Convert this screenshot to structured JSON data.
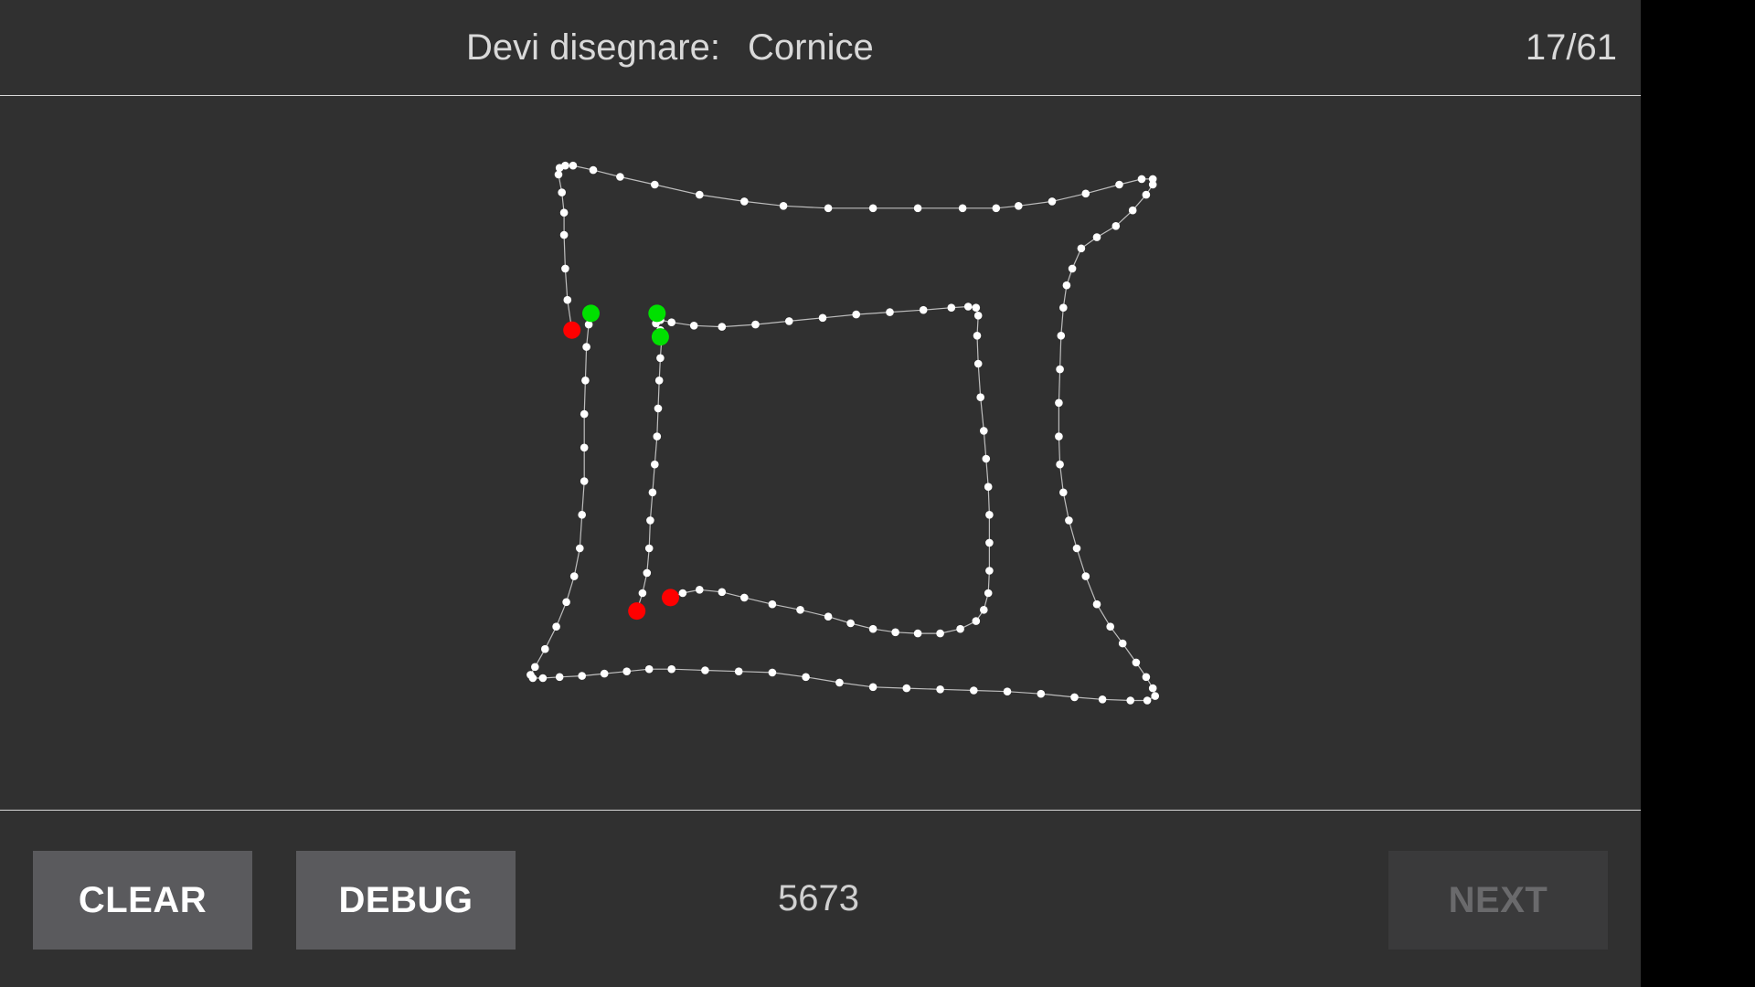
{
  "header": {
    "prompt_label": "Devi disegnare:",
    "target_word": "Cornice",
    "progress": "17/61"
  },
  "footer": {
    "clear_label": "CLEAR",
    "debug_label": "DEBUG",
    "score": "5673",
    "next_label": "NEXT"
  },
  "colors": {
    "background": "#303030",
    "stroke": "#ffffff",
    "start_marker": "#00e000",
    "end_marker": "#ff0000",
    "button": "#5a5a5d",
    "button_disabled": "#3a3a3b"
  }
}
